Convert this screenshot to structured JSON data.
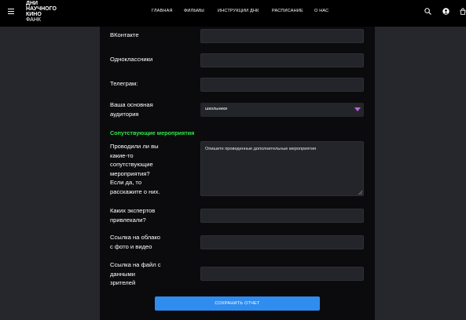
{
  "header": {
    "logo_lines": [
      "ДНИ",
      "НАУЧНОГО",
      "КИНО",
      "ФАНК"
    ],
    "nav": [
      "ГЛАВНАЯ",
      "ФИЛЬМЫ",
      "ИНСТРУКЦИИ ДНК",
      "РАСПИСАНИЕ",
      "О НАС"
    ]
  },
  "form": {
    "vk_label": "ВКонтакте",
    "ok_label": "Одноклассники",
    "telegram_label": "Телеграм:",
    "audience_label_lines": [
      "Ваша основная",
      "аудитория"
    ],
    "audience_value": "школьники",
    "section_title": "Сопутствующие мероприятия",
    "events_label_lines": [
      "Проводили ли вы",
      "какие-то",
      "сопутствующие",
      "мероприятия?",
      "Если да, то",
      "расскажите о них."
    ],
    "events_placeholder": "Опишите проведенные дополнительные мероприятия",
    "experts_label_lines": [
      "Каких экспертов",
      "привлекали?"
    ],
    "cloud_label_lines": [
      "Ссылка на облако",
      "с фото и видео"
    ],
    "viewers_label_lines": [
      "Ссылка на файл с",
      "данными",
      "зрителей"
    ],
    "save_button": "СОХРАНИТЬ ОТЧЕТ"
  }
}
